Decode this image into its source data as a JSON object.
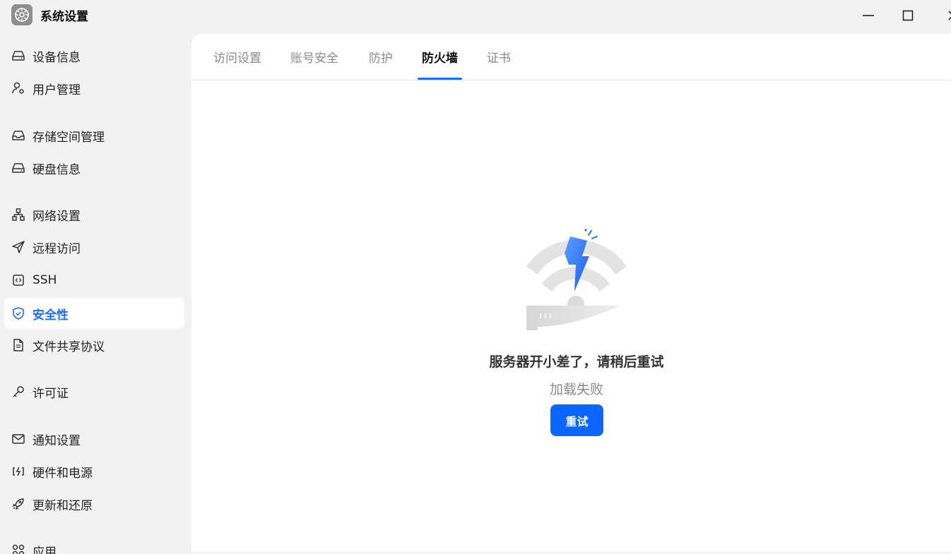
{
  "window": {
    "title": "系统设置",
    "app_icon": "gear-app-icon",
    "controls": [
      "minimize-icon",
      "maximize-icon",
      "close-icon"
    ]
  },
  "sidebar": {
    "items": [
      {
        "label": "设备信息",
        "icon": "hard-drive-icon",
        "active": false
      },
      {
        "label": "用户管理",
        "icon": "user-gear-icon",
        "active": false
      },
      {
        "label": "存储空间管理",
        "icon": "inbox-icon",
        "active": false
      },
      {
        "label": "硬盘信息",
        "icon": "hard-drive-icon",
        "active": false
      },
      {
        "label": "网络设置",
        "icon": "network-icon",
        "active": false
      },
      {
        "label": "远程访问",
        "icon": "send-icon",
        "active": false
      },
      {
        "label": "SSH",
        "icon": "code-icon",
        "active": false
      },
      {
        "label": "安全性",
        "icon": "shield-icon",
        "active": true
      },
      {
        "label": "文件共享协议",
        "icon": "document-icon",
        "active": false
      },
      {
        "label": "许可证",
        "icon": "key-icon",
        "active": false
      },
      {
        "label": "通知设置",
        "icon": "mail-icon",
        "active": false
      },
      {
        "label": "硬件和电源",
        "icon": "power-icon",
        "active": false
      },
      {
        "label": "更新和还原",
        "icon": "rocket-icon",
        "active": false
      },
      {
        "label": "应用",
        "icon": "apps-icon",
        "active": false
      }
    ]
  },
  "tabs": [
    {
      "label": "访问设置",
      "active": false
    },
    {
      "label": "账号安全",
      "active": false
    },
    {
      "label": "防护",
      "active": false
    },
    {
      "label": "防火墙",
      "active": true
    },
    {
      "label": "证书",
      "active": false
    }
  ],
  "error": {
    "title": "服务器开小差了，请稍后重试",
    "subtitle": "加载失败",
    "retry_label": "重试",
    "illustration": "wifi-lightning-icon"
  },
  "colors": {
    "accent": "#1a6cff",
    "button": "#0a66ff",
    "sidebar_bg": "#f2f2f2",
    "panel_bg": "#ffffff"
  }
}
